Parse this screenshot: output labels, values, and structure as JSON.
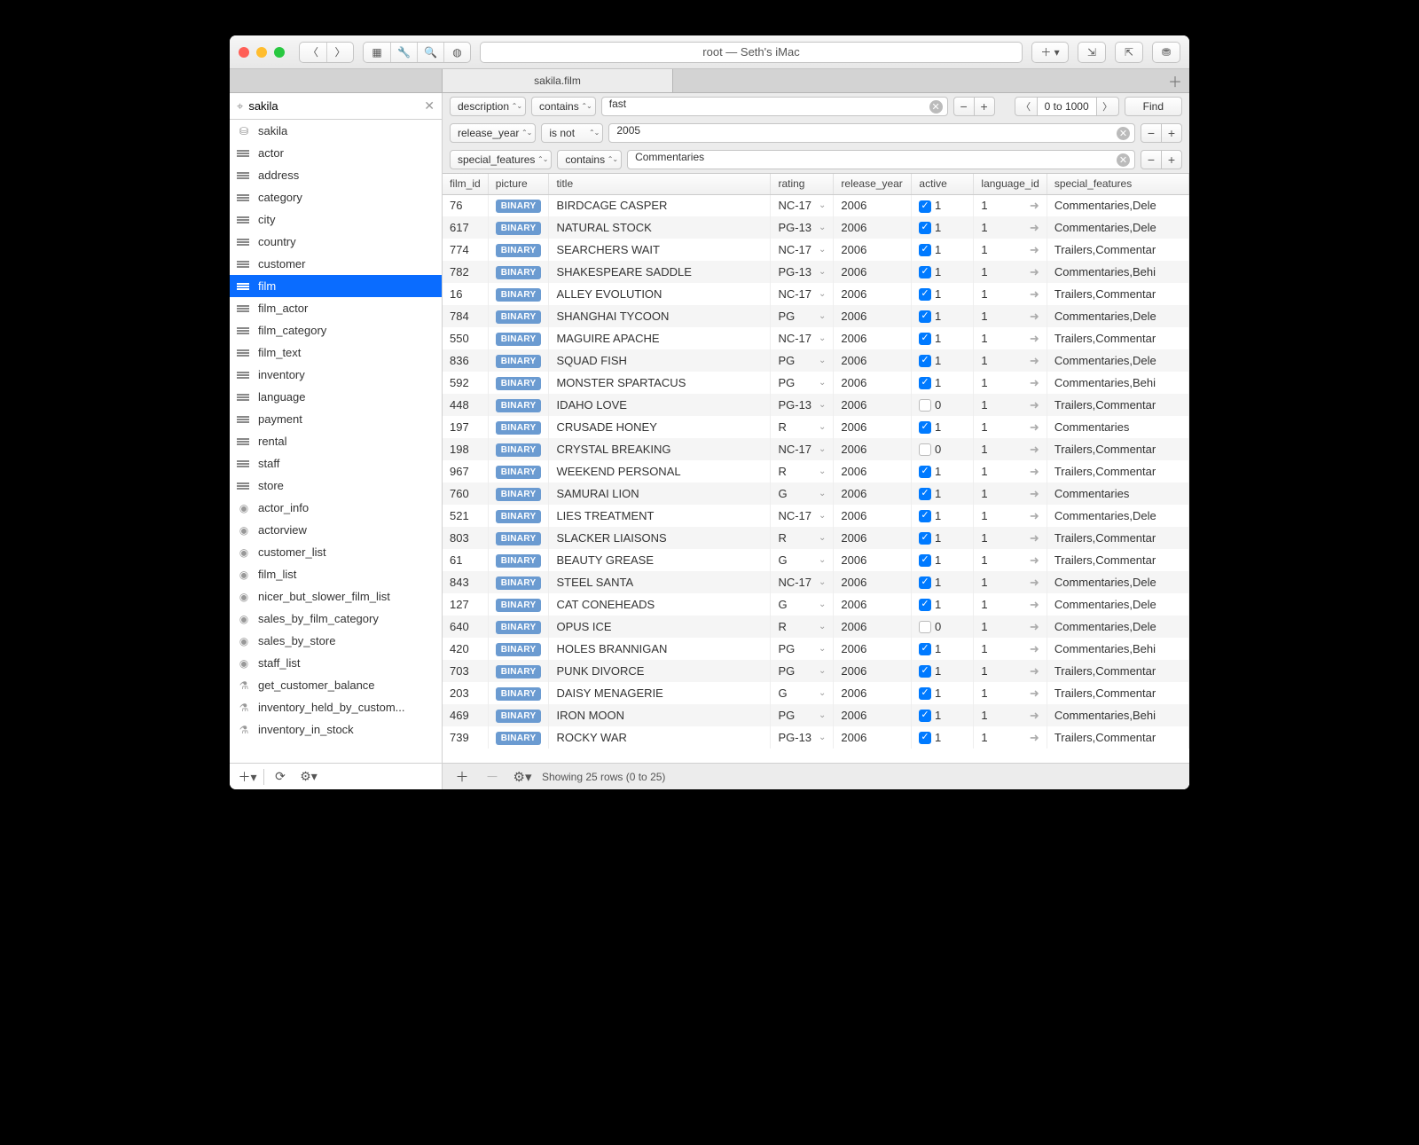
{
  "titlebar": {
    "title": "root — Seth's iMac"
  },
  "tabbar": {
    "tab1": "sakila.film"
  },
  "sidebar": {
    "search": "sakila",
    "items": [
      {
        "icon": "db",
        "label": "sakila"
      },
      {
        "icon": "table",
        "label": "actor"
      },
      {
        "icon": "table",
        "label": "address"
      },
      {
        "icon": "table",
        "label": "category"
      },
      {
        "icon": "table",
        "label": "city"
      },
      {
        "icon": "table",
        "label": "country"
      },
      {
        "icon": "table",
        "label": "customer"
      },
      {
        "icon": "table",
        "label": "film",
        "selected": true
      },
      {
        "icon": "table",
        "label": "film_actor"
      },
      {
        "icon": "table",
        "label": "film_category"
      },
      {
        "icon": "table",
        "label": "film_text"
      },
      {
        "icon": "table",
        "label": "inventory"
      },
      {
        "icon": "table",
        "label": "language"
      },
      {
        "icon": "table",
        "label": "payment"
      },
      {
        "icon": "table",
        "label": "rental"
      },
      {
        "icon": "table",
        "label": "staff"
      },
      {
        "icon": "table",
        "label": "store"
      },
      {
        "icon": "view",
        "label": "actor_info"
      },
      {
        "icon": "view",
        "label": "actorview"
      },
      {
        "icon": "view",
        "label": "customer_list"
      },
      {
        "icon": "view",
        "label": "film_list"
      },
      {
        "icon": "view",
        "label": "nicer_but_slower_film_list"
      },
      {
        "icon": "view",
        "label": "sales_by_film_category"
      },
      {
        "icon": "view",
        "label": "sales_by_store"
      },
      {
        "icon": "view",
        "label": "staff_list"
      },
      {
        "icon": "func",
        "label": "get_customer_balance"
      },
      {
        "icon": "func",
        "label": "inventory_held_by_custom..."
      },
      {
        "icon": "func",
        "label": "inventory_in_stock"
      }
    ]
  },
  "filters": [
    {
      "field": "description",
      "op": "contains",
      "value": "fast"
    },
    {
      "field": "release_year",
      "op": "is not",
      "value": "2005"
    },
    {
      "field": "special_features",
      "op": "contains",
      "value": "Commentaries"
    }
  ],
  "nav": {
    "range": "0 to 1000",
    "find": "Find"
  },
  "columns": [
    "film_id",
    "picture",
    "title",
    "rating",
    "release_year",
    "active",
    "language_id",
    "special_features"
  ],
  "rows": [
    {
      "film_id": "76",
      "title": "BIRDCAGE CASPER",
      "rating": "NC-17",
      "release_year": "2006",
      "active": true,
      "active_val": "1",
      "language_id": "1",
      "special_features": "Commentaries,Dele"
    },
    {
      "film_id": "617",
      "title": "NATURAL STOCK",
      "rating": "PG-13",
      "release_year": "2006",
      "active": true,
      "active_val": "1",
      "language_id": "1",
      "special_features": "Commentaries,Dele"
    },
    {
      "film_id": "774",
      "title": "SEARCHERS WAIT",
      "rating": "NC-17",
      "release_year": "2006",
      "active": true,
      "active_val": "1",
      "language_id": "1",
      "special_features": "Trailers,Commentar"
    },
    {
      "film_id": "782",
      "title": "SHAKESPEARE SADDLE",
      "rating": "PG-13",
      "release_year": "2006",
      "active": true,
      "active_val": "1",
      "language_id": "1",
      "special_features": "Commentaries,Behi"
    },
    {
      "film_id": "16",
      "title": "ALLEY EVOLUTION",
      "rating": "NC-17",
      "release_year": "2006",
      "active": true,
      "active_val": "1",
      "language_id": "1",
      "special_features": "Trailers,Commentar"
    },
    {
      "film_id": "784",
      "title": "SHANGHAI TYCOON",
      "rating": "PG",
      "release_year": "2006",
      "active": true,
      "active_val": "1",
      "language_id": "1",
      "special_features": "Commentaries,Dele"
    },
    {
      "film_id": "550",
      "title": "MAGUIRE APACHE",
      "rating": "NC-17",
      "release_year": "2006",
      "active": true,
      "active_val": "1",
      "language_id": "1",
      "special_features": "Trailers,Commentar"
    },
    {
      "film_id": "836",
      "title": "SQUAD FISH",
      "rating": "PG",
      "release_year": "2006",
      "active": true,
      "active_val": "1",
      "language_id": "1",
      "special_features": "Commentaries,Dele"
    },
    {
      "film_id": "592",
      "title": "MONSTER SPARTACUS",
      "rating": "PG",
      "release_year": "2006",
      "active": true,
      "active_val": "1",
      "language_id": "1",
      "special_features": "Commentaries,Behi"
    },
    {
      "film_id": "448",
      "title": "IDAHO LOVE",
      "rating": "PG-13",
      "release_year": "2006",
      "active": false,
      "active_val": "0",
      "language_id": "1",
      "special_features": "Trailers,Commentar"
    },
    {
      "film_id": "197",
      "title": "CRUSADE HONEY",
      "rating": "R",
      "release_year": "2006",
      "active": true,
      "active_val": "1",
      "language_id": "1",
      "special_features": "Commentaries"
    },
    {
      "film_id": "198",
      "title": "CRYSTAL BREAKING",
      "rating": "NC-17",
      "release_year": "2006",
      "active": false,
      "active_val": "0",
      "language_id": "1",
      "special_features": "Trailers,Commentar"
    },
    {
      "film_id": "967",
      "title": "WEEKEND PERSONAL",
      "rating": "R",
      "release_year": "2006",
      "active": true,
      "active_val": "1",
      "language_id": "1",
      "special_features": "Trailers,Commentar"
    },
    {
      "film_id": "760",
      "title": "SAMURAI LION",
      "rating": "G",
      "release_year": "2006",
      "active": true,
      "active_val": "1",
      "language_id": "1",
      "special_features": "Commentaries"
    },
    {
      "film_id": "521",
      "title": "LIES TREATMENT",
      "rating": "NC-17",
      "release_year": "2006",
      "active": true,
      "active_val": "1",
      "language_id": "1",
      "special_features": "Commentaries,Dele"
    },
    {
      "film_id": "803",
      "title": "SLACKER LIAISONS",
      "rating": "R",
      "release_year": "2006",
      "active": true,
      "active_val": "1",
      "language_id": "1",
      "special_features": "Trailers,Commentar"
    },
    {
      "film_id": "61",
      "title": "BEAUTY GREASE",
      "rating": "G",
      "release_year": "2006",
      "active": true,
      "active_val": "1",
      "language_id": "1",
      "special_features": "Trailers,Commentar"
    },
    {
      "film_id": "843",
      "title": "STEEL SANTA",
      "rating": "NC-17",
      "release_year": "2006",
      "active": true,
      "active_val": "1",
      "language_id": "1",
      "special_features": "Commentaries,Dele"
    },
    {
      "film_id": "127",
      "title": "CAT CONEHEADS",
      "rating": "G",
      "release_year": "2006",
      "active": true,
      "active_val": "1",
      "language_id": "1",
      "special_features": "Commentaries,Dele"
    },
    {
      "film_id": "640",
      "title": "OPUS ICE",
      "rating": "R",
      "release_year": "2006",
      "active": false,
      "active_val": "0",
      "language_id": "1",
      "special_features": "Commentaries,Dele"
    },
    {
      "film_id": "420",
      "title": "HOLES BRANNIGAN",
      "rating": "PG",
      "release_year": "2006",
      "active": true,
      "active_val": "1",
      "language_id": "1",
      "special_features": "Commentaries,Behi"
    },
    {
      "film_id": "703",
      "title": "PUNK DIVORCE",
      "rating": "PG",
      "release_year": "2006",
      "active": true,
      "active_val": "1",
      "language_id": "1",
      "special_features": "Trailers,Commentar"
    },
    {
      "film_id": "203",
      "title": "DAISY MENAGERIE",
      "rating": "G",
      "release_year": "2006",
      "active": true,
      "active_val": "1",
      "language_id": "1",
      "special_features": "Trailers,Commentar"
    },
    {
      "film_id": "469",
      "title": "IRON MOON",
      "rating": "PG",
      "release_year": "2006",
      "active": true,
      "active_val": "1",
      "language_id": "1",
      "special_features": "Commentaries,Behi"
    },
    {
      "film_id": "739",
      "title": "ROCKY WAR",
      "rating": "PG-13",
      "release_year": "2006",
      "active": true,
      "active_val": "1",
      "language_id": "1",
      "special_features": "Trailers,Commentar"
    }
  ],
  "picture_badge": "BINARY",
  "footer": {
    "status": "Showing 25 rows (0 to 25)"
  }
}
